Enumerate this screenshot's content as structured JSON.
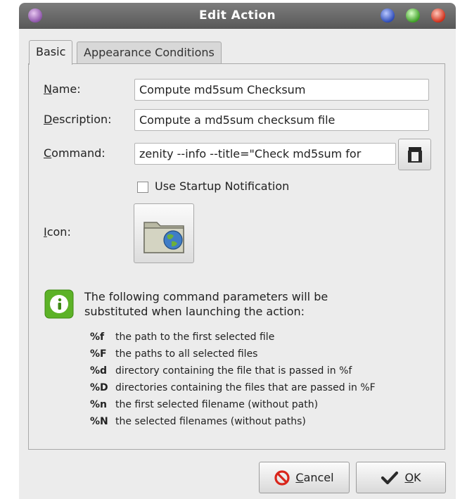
{
  "window": {
    "title": "Edit Action"
  },
  "tabs": [
    {
      "label": "Basic"
    },
    {
      "label": "Appearance Conditions"
    }
  ],
  "form": {
    "name_label_first": "N",
    "name_label_rest": "ame:",
    "name_value": "Compute md5sum Checksum",
    "desc_label_first": "D",
    "desc_label_rest": "escription:",
    "desc_value": "Compute a md5sum checksum file",
    "cmd_label_first": "C",
    "cmd_label_rest": "ommand:",
    "cmd_value": "zenity --info --title=\"Check md5sum for",
    "startup_label": "Use Startup Notification",
    "startup_checked": false,
    "icon_label_first": "I",
    "icon_label_rest": "con:"
  },
  "info": {
    "line1": "The following command parameters will be",
    "line2": "substituted when launching the action:",
    "params": [
      {
        "key": "%f",
        "desc": "the path to the first selected file"
      },
      {
        "key": "%F",
        "desc": "the paths to all selected files"
      },
      {
        "key": "%d",
        "desc": "directory containing the file that is passed in %f"
      },
      {
        "key": "%D",
        "desc": "directories containing the files that are passed in %F"
      },
      {
        "key": "%n",
        "desc": "the first selected filename (without path)"
      },
      {
        "key": "%N",
        "desc": "the selected filenames (without paths)"
      }
    ]
  },
  "buttons": {
    "cancel_first": "C",
    "cancel_rest": "ancel",
    "ok_first": "O",
    "ok_rest": "K"
  },
  "colors": {
    "titlebar": "#575757",
    "info_icon": "#5cb227",
    "cancel_icon": "#d9261c"
  }
}
